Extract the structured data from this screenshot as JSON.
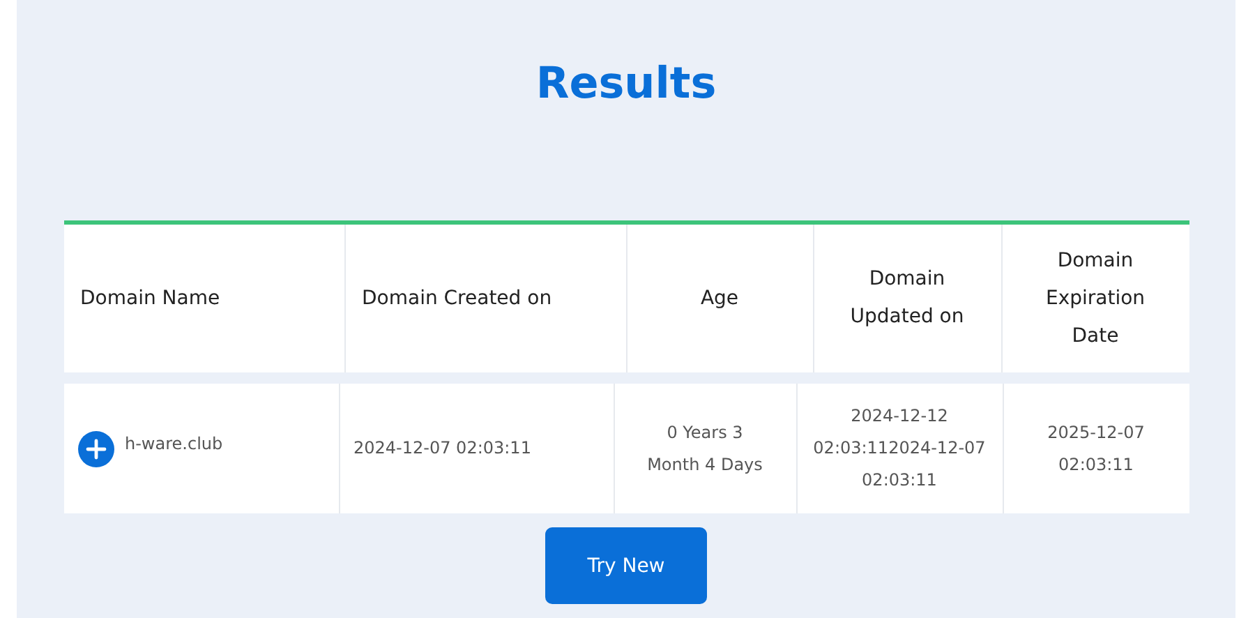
{
  "title": "Results",
  "table": {
    "columns": [
      "Domain Name",
      "Domain Created on",
      "Age",
      "Domain Updated on",
      "Domain Expiration Date"
    ],
    "rows": [
      {
        "cells": [
          "h-ware.club",
          "2024-12-07 02:03:11",
          "0 Years 3 Month 4 Days",
          "2024-12-12 02:03:112024-12-07 02:03:11",
          "2025-12-07 02:03:11"
        ],
        "expanded": false
      }
    ]
  },
  "button": "Try New"
}
